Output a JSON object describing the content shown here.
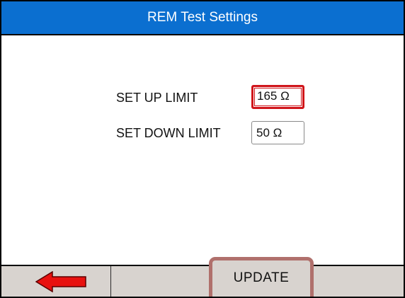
{
  "header": {
    "title": "REM Test Settings"
  },
  "settings": {
    "up_limit": {
      "label": "SET UP LIMIT",
      "value": "165 Ω"
    },
    "down_limit": {
      "label": "SET DOWN LIMIT",
      "value": "50 Ω"
    }
  },
  "footer": {
    "back_icon": "left-arrow-icon",
    "update_label": "UPDATE"
  },
  "colors": {
    "title_bar": "#0b6fd0",
    "selection": "#d0141a",
    "arrow": "#e8110f",
    "footer_bg": "#d8d3cf"
  }
}
